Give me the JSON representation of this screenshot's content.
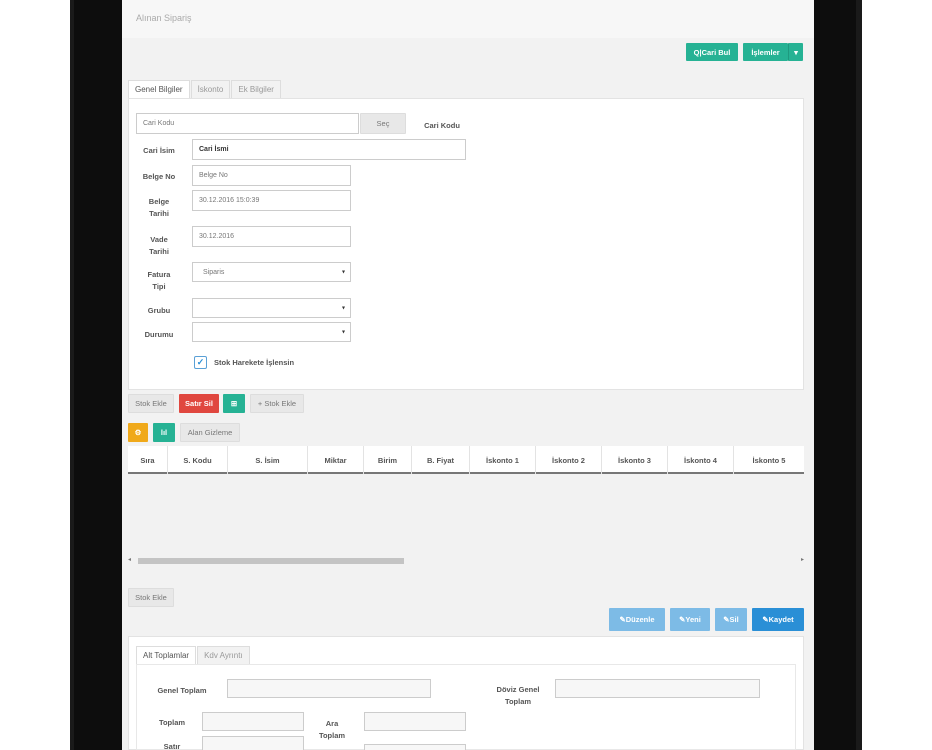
{
  "page": {
    "title": "Alınan Sipariş"
  },
  "header_buttons": {
    "cari_bul": "Q|Cari Bul",
    "islemler": "İşlemler",
    "islemler_caret": "▾"
  },
  "tabs": [
    {
      "label": "Genel Bilgiler",
      "active": true
    },
    {
      "label": "İskonto",
      "active": false
    },
    {
      "label": "Ek Bilgiler",
      "active": false
    }
  ],
  "form": {
    "cari_kodu_placeholder": "Cari Kodu",
    "sec_label": "Seç",
    "cari_kodu_label": "Cari Kodu",
    "cari_isim_label": "Cari İsim",
    "cari_isim_value": "Cari İsmi",
    "belge_no_label": "Belge No",
    "belge_no_value": "Belge No",
    "belge_tarihi_label1": "Belge",
    "belge_tarihi_label2": "Tarihi",
    "belge_tarihi_value": "30.12.2016 15:0:39",
    "vade_tarihi_label1": "Vade",
    "vade_tarihi_label2": "Tarihi",
    "vade_tarihi_value": "30.12.2016",
    "fatura_tipi_label1": "Fatura",
    "fatura_tipi_label2": "Tipi",
    "fatura_tipi_value": "Siparis",
    "grubu_label": "Grubu",
    "grubu_value": "",
    "durumu_label": "Durumu",
    "durumu_value": "",
    "stok_checkbox_label": "Stok Harekete İşlensin",
    "stok_checkbox_checked": "✓",
    "select_caret": "▾"
  },
  "toolbar": {
    "stok_ekle": "Stok Ekle",
    "satir_sil": "Satır Sil",
    "grid_icon": "⊞",
    "plus_stok_ekle": "+ Stok Ekle",
    "gear_icon": "⚙",
    "excel_icon": "lıl",
    "alan_gizleme": "Alan Gizleme"
  },
  "grid": {
    "columns": [
      "Sıra",
      "S. Kodu",
      "S. İsim",
      "Miktar",
      "Birim",
      "B. Fiyat",
      "İskonto 1",
      "İskonto 2",
      "İskonto 3",
      "İskonto 4",
      "İskonto 5"
    ],
    "rows": [],
    "scroll_left": "◂",
    "scroll_right": "▸"
  },
  "bottom": {
    "stok_ekle": "Stok Ekle",
    "duzenle": "✎Düzenle",
    "yeni": "✎Yeni",
    "sil": "✎Sil",
    "kaydet": "✎Kaydet"
  },
  "totals_tabs": [
    {
      "label": "Alt Toplamlar",
      "active": true
    },
    {
      "label": "Kdv Ayrıntı",
      "active": false
    }
  ],
  "totals": {
    "genel_toplam": "Genel Toplam",
    "doviz_genel_1": "Döviz Genel",
    "doviz_genel_2": "Toplam",
    "toplam": "Toplam",
    "ara_1": "Ara",
    "ara_2": "Toplam",
    "satir": "Satır"
  },
  "colors": {
    "green": "#26b294",
    "red": "#e0473f",
    "blue": "#2a8fd6",
    "lightblue": "#7dbbe6",
    "orange": "#f0a91a"
  }
}
